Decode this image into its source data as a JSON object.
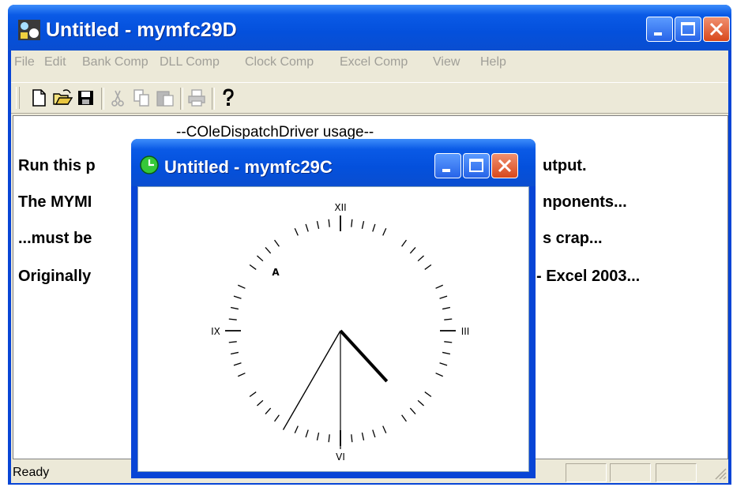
{
  "main_window": {
    "title": "Untitled - mymfc29D",
    "menu": [
      "File",
      "Edit",
      "Bank Comp",
      "DLL Comp",
      "Clock Comp",
      "Excel Comp",
      "View",
      "Help"
    ],
    "toolbar": [
      "new-icon",
      "open-icon",
      "save-icon",
      "cut-icon",
      "copy-icon",
      "paste-icon",
      "print-icon",
      "help-icon"
    ],
    "view": {
      "title": "--COleDispatchDriver usage--",
      "lines": [
        "Run this p",
        "The MYMI",
        "...must be",
        "Originally"
      ],
      "right_lines": [
        "utput.",
        "nponents...",
        "s crap...",
        "- Excel 2003..."
      ]
    },
    "status": "Ready"
  },
  "child_window": {
    "title": "Untitled - mymfc29C",
    "clock": {
      "numerals": {
        "top": "XII",
        "right": "III",
        "bottom": "VI",
        "left": "IX"
      },
      "alarm_marker": "A",
      "hour": 4,
      "minute": 35,
      "second": 30
    }
  },
  "colors": {
    "titlebar": "#0450dc",
    "close_button": "#d8481c",
    "menu_text": "#a09f98",
    "client_bg": "#ece9d8"
  }
}
